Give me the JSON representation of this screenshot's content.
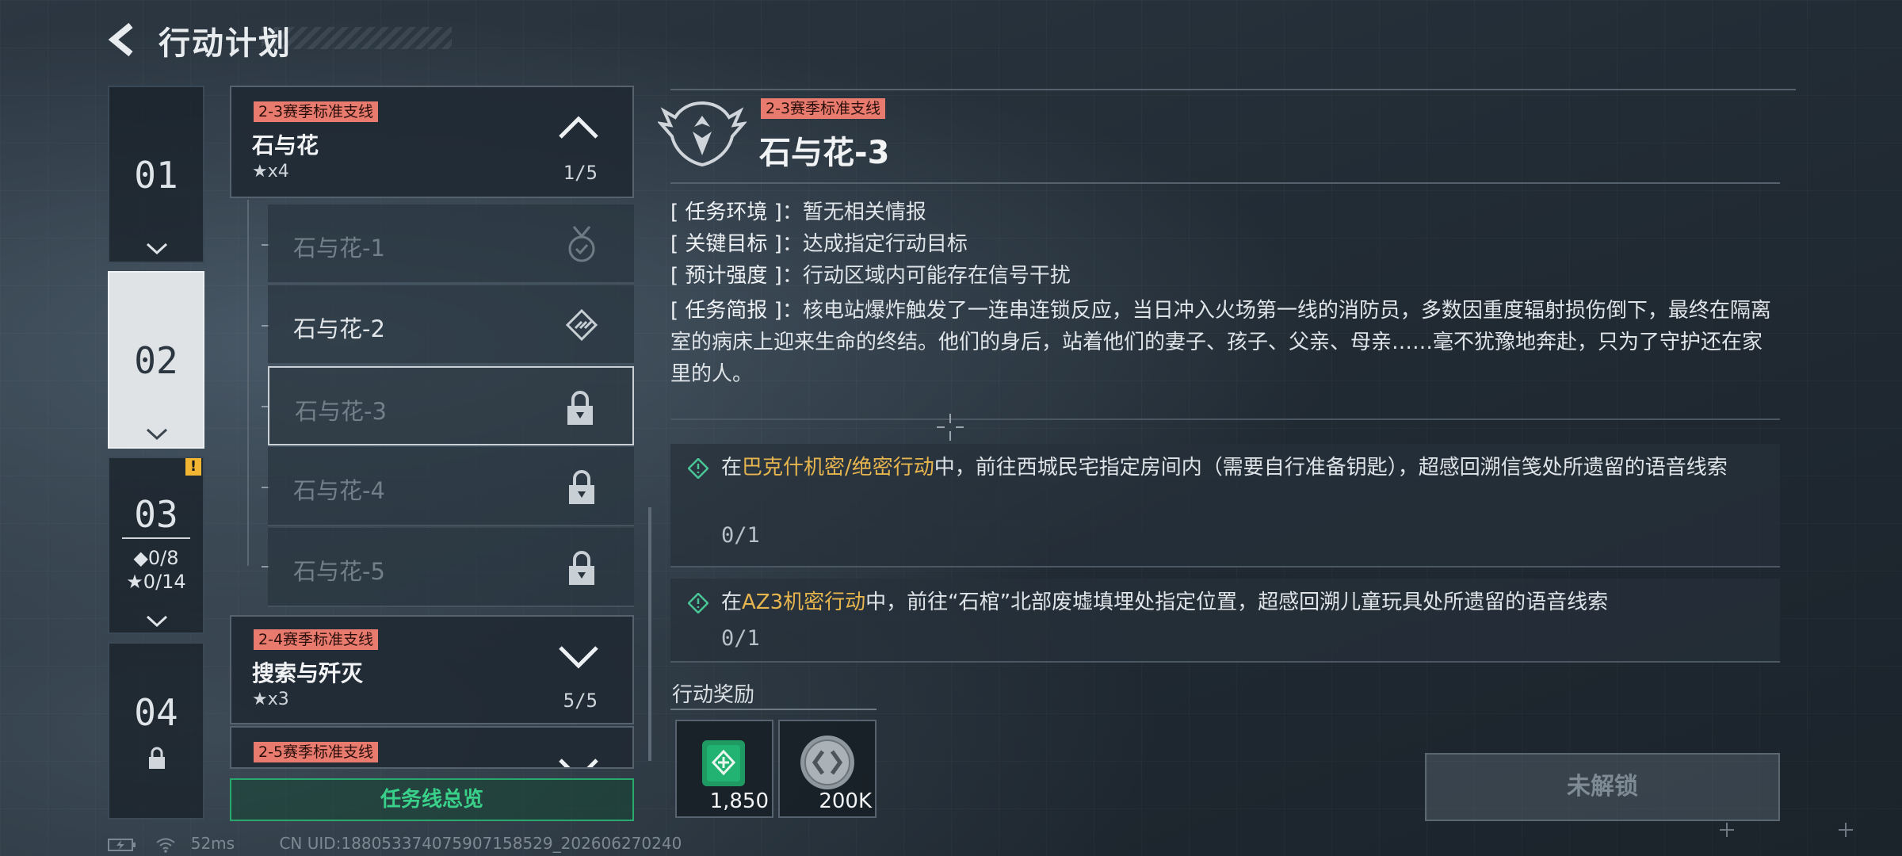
{
  "header": {
    "title": "行动计划",
    "back_icon": "back-arrow-icon"
  },
  "chapters": [
    {
      "num": "01"
    },
    {
      "num": "02"
    },
    {
      "num": "03",
      "diamond_stat": "◆0/8",
      "star_stat": "★0/14"
    },
    {
      "num": "04"
    }
  ],
  "groups": [
    {
      "tag": "2-3赛季标准支线",
      "name": "石与花",
      "stars": "★x4",
      "progress": "1/5"
    },
    {
      "tag": "2-4赛季标准支线",
      "name": "搜索与歼灭",
      "stars": "★x3",
      "progress": "5/5"
    },
    {
      "tag": "2-5赛季标准支线"
    }
  ],
  "sub_missions": [
    {
      "label": "石与花-1",
      "icon": "medal-check-icon"
    },
    {
      "label": "石与花-2",
      "icon": "diamond-striped-icon"
    },
    {
      "label": "石与花-3",
      "icon": "lock-icon"
    },
    {
      "label": "石与花-4",
      "icon": "lock-icon"
    },
    {
      "label": "石与花-5",
      "icon": "lock-icon"
    }
  ],
  "overview_button": "任务线总览",
  "detail": {
    "tag": "2-3赛季标准支线",
    "title": "石与花-3",
    "info": [
      {
        "key": "[ 任务环境 ]",
        "value": "：暂无相关情报"
      },
      {
        "key": "[ 关键目标 ]",
        "value": "：达成指定行动目标"
      },
      {
        "key": "[ 预计强度 ]",
        "value": "：行动区域内可能存在信号干扰"
      },
      {
        "key": "[ 任务简报 ]",
        "value": "：核电站爆炸触发了一连串连锁反应，当日冲入火场第一线的消防员，多数因重度辐射损伤倒下，最终在隔离室的病床上迎来生命的终结。他们的身后，站着他们的妻子、孩子、父亲、母亲……毫不犹豫地奔赴，只为了守护还在家里的人。"
      }
    ],
    "objectives": [
      {
        "pre": "在",
        "highlight": "巴克什机密/绝密行动",
        "post": "中，前往西城民宅指定房间内（需要自行准备钥匙），超感回溯信笺处所遗留的语音线索",
        "progress": "0/1"
      },
      {
        "pre": "在",
        "highlight": "AZ3机密行动",
        "post": "中，前往“石棺”北部废墟填埋处指定位置，超感回溯儿童玩具处所遗留的语音线索",
        "progress": "0/1"
      }
    ],
    "rewards_label": "行动奖励",
    "rewards": [
      {
        "icon": "green-supply-icon",
        "qty": "1,850"
      },
      {
        "icon": "silver-coin-icon",
        "qty": "200K"
      }
    ],
    "unlock_button": "未解锁"
  },
  "status": {
    "ping": "52ms",
    "uid": "CN UID:18805337407590715852​9_202606270240"
  },
  "colors": {
    "accent_green": "#39d08a",
    "tag_red": "#e97b6e",
    "highlight_gold": "#e7b54d"
  }
}
